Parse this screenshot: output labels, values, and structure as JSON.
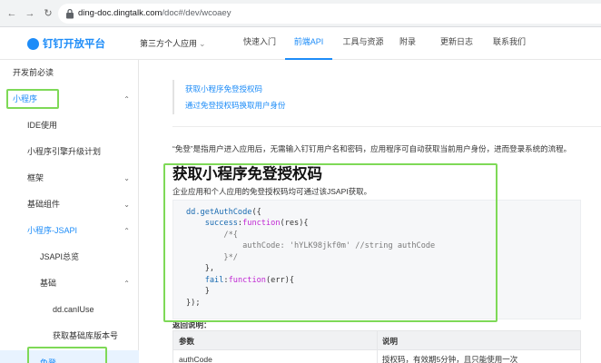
{
  "browser": {
    "url_domain": "ding-doc.dingtalk.com",
    "url_path": "/doc#/dev/wcoaey"
  },
  "header": {
    "logo_text": "钉钉开放平台",
    "scope_label": "第三方个人应用",
    "nav": [
      "快速入门",
      "前端API",
      "工具与资源",
      "附录",
      "更新日志",
      "联系我们"
    ],
    "active_nav": "前端API"
  },
  "sidebar": {
    "items": [
      {
        "label": "开发前必读"
      },
      {
        "label": "小程序"
      },
      {
        "label": "IDE使用"
      },
      {
        "label": "小程序引擎升级计划"
      },
      {
        "label": "框架"
      },
      {
        "label": "基础组件"
      },
      {
        "label": "小程序-JSAPI"
      },
      {
        "label": "JSAPI总览"
      },
      {
        "label": "基础"
      },
      {
        "label": "dd.canIUse"
      },
      {
        "label": "获取基础库版本号"
      },
      {
        "label": "免登"
      }
    ]
  },
  "content": {
    "toc": [
      "获取小程序免登授权码",
      "通过免登授权码换取用户身份"
    ],
    "intro": "“免登”是指用户进入应用后，无需输入钉钉用户名和密码，应用程序可自动获取当前用户身份，进而登录系统的流程。",
    "title": "获取小程序免登授权码",
    "description": "企业应用和个人应用的免登授权码均可通过该JSAPI获取。",
    "code": {
      "l1_call": "dd.getAuthCode",
      "l1_rest": "({",
      "l2_prop": "success",
      "l2_fn": "function",
      "l2_rest": "(res){",
      "l3": "/*{",
      "l4": "authCode: 'hYLK98jkf0m' //string authCode",
      "l5": "}*/",
      "l6": "},",
      "l7_prop": "fail",
      "l7_fn": "function",
      "l7_rest": "(err){",
      "l8": "}",
      "l9": "});"
    },
    "return_label": "返回说明：",
    "table": {
      "headers": [
        "参数",
        "说明"
      ],
      "rows": [
        [
          "authCode",
          "授权码，有效期5分钟，且只能使用一次"
        ]
      ]
    }
  },
  "colors": {
    "accent": "#1d8cf8",
    "annotation": "#7ed957"
  }
}
